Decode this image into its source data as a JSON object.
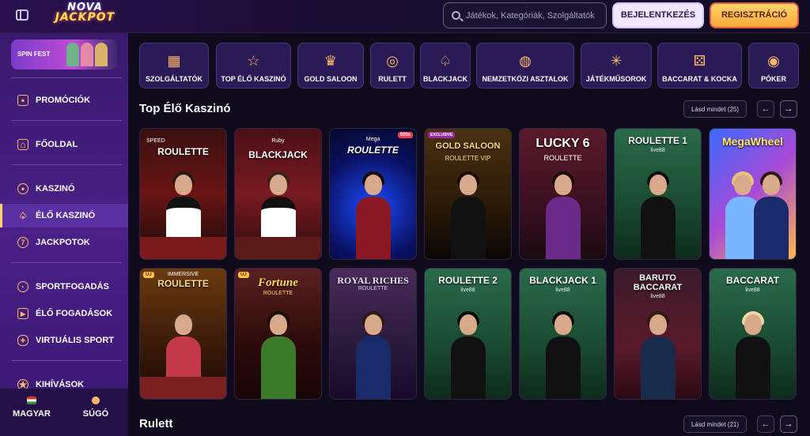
{
  "header": {
    "logo_line1": "NOVA",
    "logo_line2": "JACKPOT",
    "search_placeholder": "Játékok, Kategóriák, Szolgáltatók",
    "login_label": "BEJELENTKEZÉS",
    "register_label": "REGISZTRÁCIÓ"
  },
  "sidebar": {
    "promo_label": "SPIN FEST",
    "items": [
      {
        "label": "PROMÓCIÓK",
        "icon": "gift-icon"
      },
      {
        "label": "FŐOLDAL",
        "icon": "home-icon"
      },
      {
        "label": "KASZINÓ",
        "icon": "roulette-icon"
      },
      {
        "label": "ÉLŐ KASZINÓ",
        "icon": "spade-icon"
      },
      {
        "label": "JACKPOTOK",
        "icon": "seven-icon"
      },
      {
        "label": "SPORTFOGADÁS",
        "icon": "ball-icon"
      },
      {
        "label": "ÉLŐ FOGADÁSOK",
        "icon": "live-icon"
      },
      {
        "label": "VIRTUÁLIS SPORT",
        "icon": "gamepad-icon"
      },
      {
        "label": "KIHÍVÁSOK",
        "icon": "medal-icon"
      }
    ],
    "language_label": "MAGYAR",
    "help_label": "SÚGÓ"
  },
  "categories": [
    {
      "label": "SZOLGÁLTATÓK",
      "icon": "grid-icon"
    },
    {
      "label": "TOP ÉLŐ KASZINÓ",
      "icon": "star-icon"
    },
    {
      "label": "GOLD SALOON",
      "icon": "crown-icon"
    },
    {
      "label": "RULETT",
      "icon": "roulette-icon"
    },
    {
      "label": "BLACKJACK",
      "icon": "spade-icon"
    },
    {
      "label": "NEMZETKÖZI ASZTALOK",
      "icon": "globe-icon"
    },
    {
      "label": "JÁTÉKMŰSOROK",
      "icon": "wheel-icon"
    },
    {
      "label": "BACCARAT & KOCKA",
      "icon": "dice-icon"
    },
    {
      "label": "PÓKER",
      "icon": "chip-icon"
    }
  ],
  "sections": [
    {
      "title": "Top Élő Kaszinó",
      "see_all": "Lásd mindet (25)"
    },
    {
      "title": "Rulett",
      "see_all": "Lásd mindet (21)"
    }
  ],
  "arrows": {
    "prev": "←",
    "next": "→"
  },
  "games_row1": [
    {
      "title": "ROULETTE",
      "sub": "SPEED",
      "badge": ""
    },
    {
      "title": "BLACKJACK",
      "sub": "Ruby",
      "badge": ""
    },
    {
      "title": "ROULETTE",
      "sub": "Mega",
      "badge": "500x"
    },
    {
      "title": "GOLD SALOON",
      "sub": "ROULETTE VIP",
      "badge": "EXCLUSIVE"
    },
    {
      "title": "LUCKY 6",
      "sub": "ROULETTE",
      "badge": ""
    },
    {
      "title": "ROULETTE 1",
      "sub": "live88",
      "badge": ""
    },
    {
      "title": "MegaWheel",
      "sub": "",
      "badge": ""
    }
  ],
  "games_row2": [
    {
      "title": "ROULETTE",
      "sub": "IMMERSIVE",
      "badge": "ÚJ"
    },
    {
      "title": "Fortune",
      "sub": "ROULETTE",
      "badge": "ÚJ"
    },
    {
      "title": "ROYAL RICHES",
      "sub": "ROULETTE",
      "badge": ""
    },
    {
      "title": "ROULETTE 2",
      "sub": "live88",
      "badge": ""
    },
    {
      "title": "BLACKJACK 1",
      "sub": "live88",
      "badge": ""
    },
    {
      "title": "BARUTO BACCARAT",
      "sub": "live88",
      "badge": ""
    },
    {
      "title": "BACCARAT",
      "sub": "live88",
      "badge": ""
    }
  ]
}
